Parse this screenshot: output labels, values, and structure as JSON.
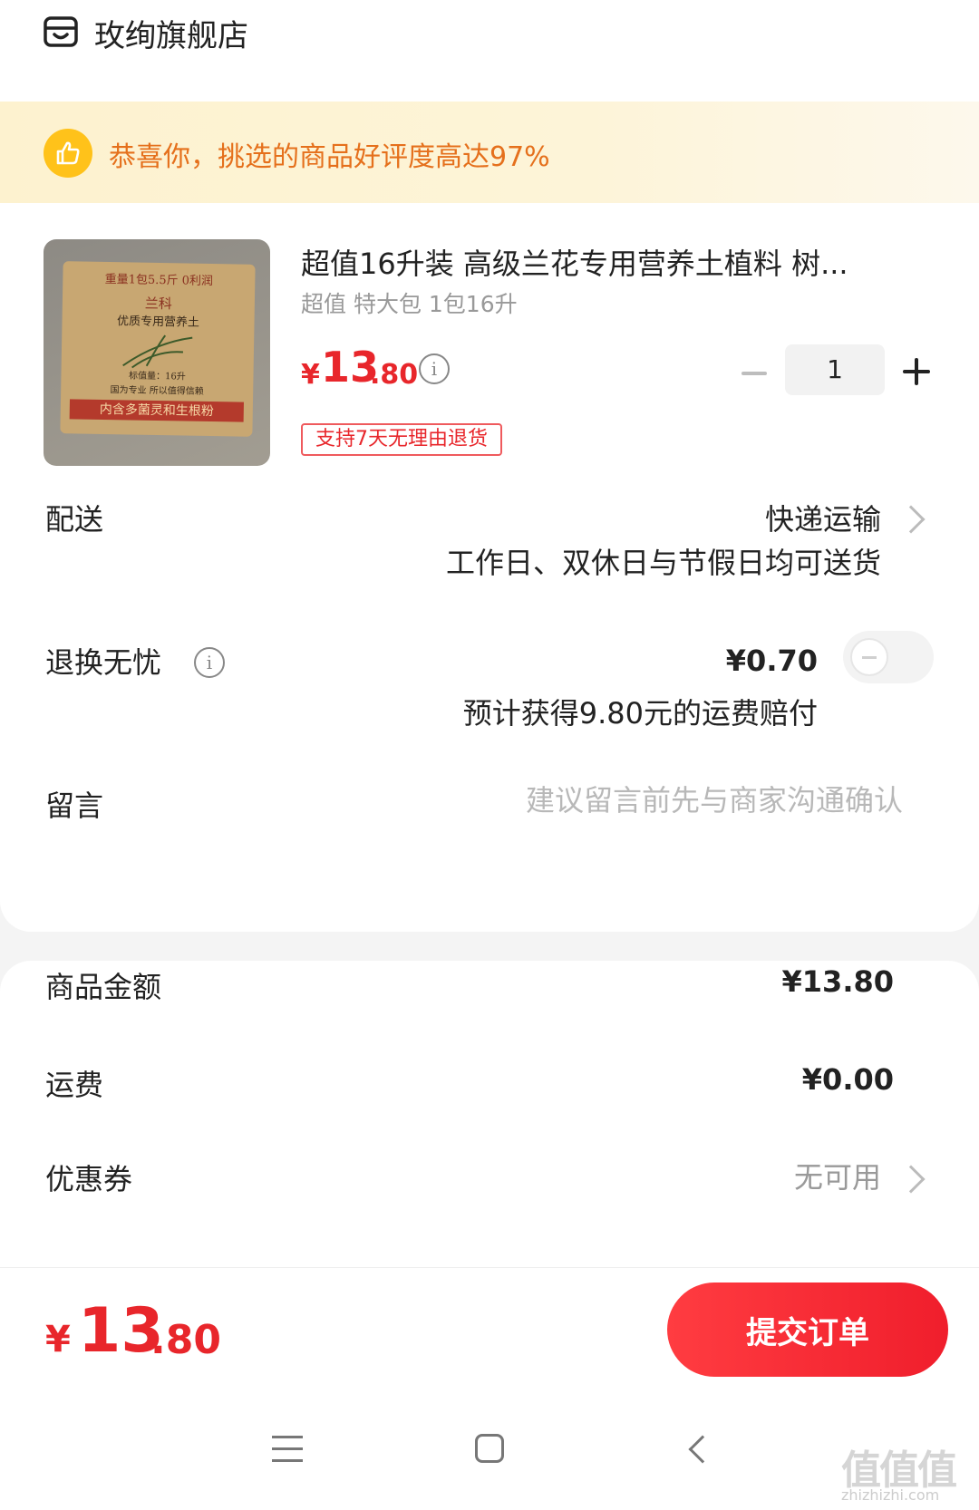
{
  "store": {
    "name": "玫绚旗舰店",
    "icon": "store-icon"
  },
  "praise": {
    "text": "恭喜你，挑选的商品好评度高达97%",
    "icon": "thumbs-up-icon",
    "color": "#e5701c"
  },
  "product": {
    "title": "超值16升装 高级兰花专用营养土植料 树...",
    "spec": "超值 特大包 1包16升",
    "price": {
      "currency": "¥",
      "integer": "13",
      "decimal": ".80"
    },
    "quantity": "1",
    "return_tag": "支持7天无理由退货",
    "image_text": {
      "line1": "重量1包5.5斤  0利润",
      "line2": "兰科",
      "line3": "优质专用营养土",
      "line4": "标值量：16升",
      "line5": "国为专业 所以值得信赖",
      "line6": "内含多菌灵和生根粉"
    }
  },
  "delivery": {
    "label": "配送",
    "value": "快递运输",
    "sub": "工作日、双休日与节假日均可送货"
  },
  "exchange": {
    "label": "退换无忧",
    "price": "¥0.70",
    "sub": "预计获得9.80元的运费赔付",
    "enabled": false
  },
  "message": {
    "label": "留言",
    "placeholder": "建议留言前先与商家沟通确认"
  },
  "summary": {
    "goods_label": "商品金额",
    "goods_value": "¥13.80",
    "shipping_label": "运费",
    "shipping_value": "¥0.00",
    "coupon_label": "优惠券",
    "coupon_value": "无可用"
  },
  "footer": {
    "total_currency": "¥",
    "total_integer": "13",
    "total_decimal": ".80",
    "submit_label": "提交订单"
  },
  "watermark": {
    "text": "值值值",
    "sub": "zhizhizhi.com"
  },
  "colors": {
    "accent": "#e8262b",
    "banner_bg": "#fdf2cf"
  }
}
